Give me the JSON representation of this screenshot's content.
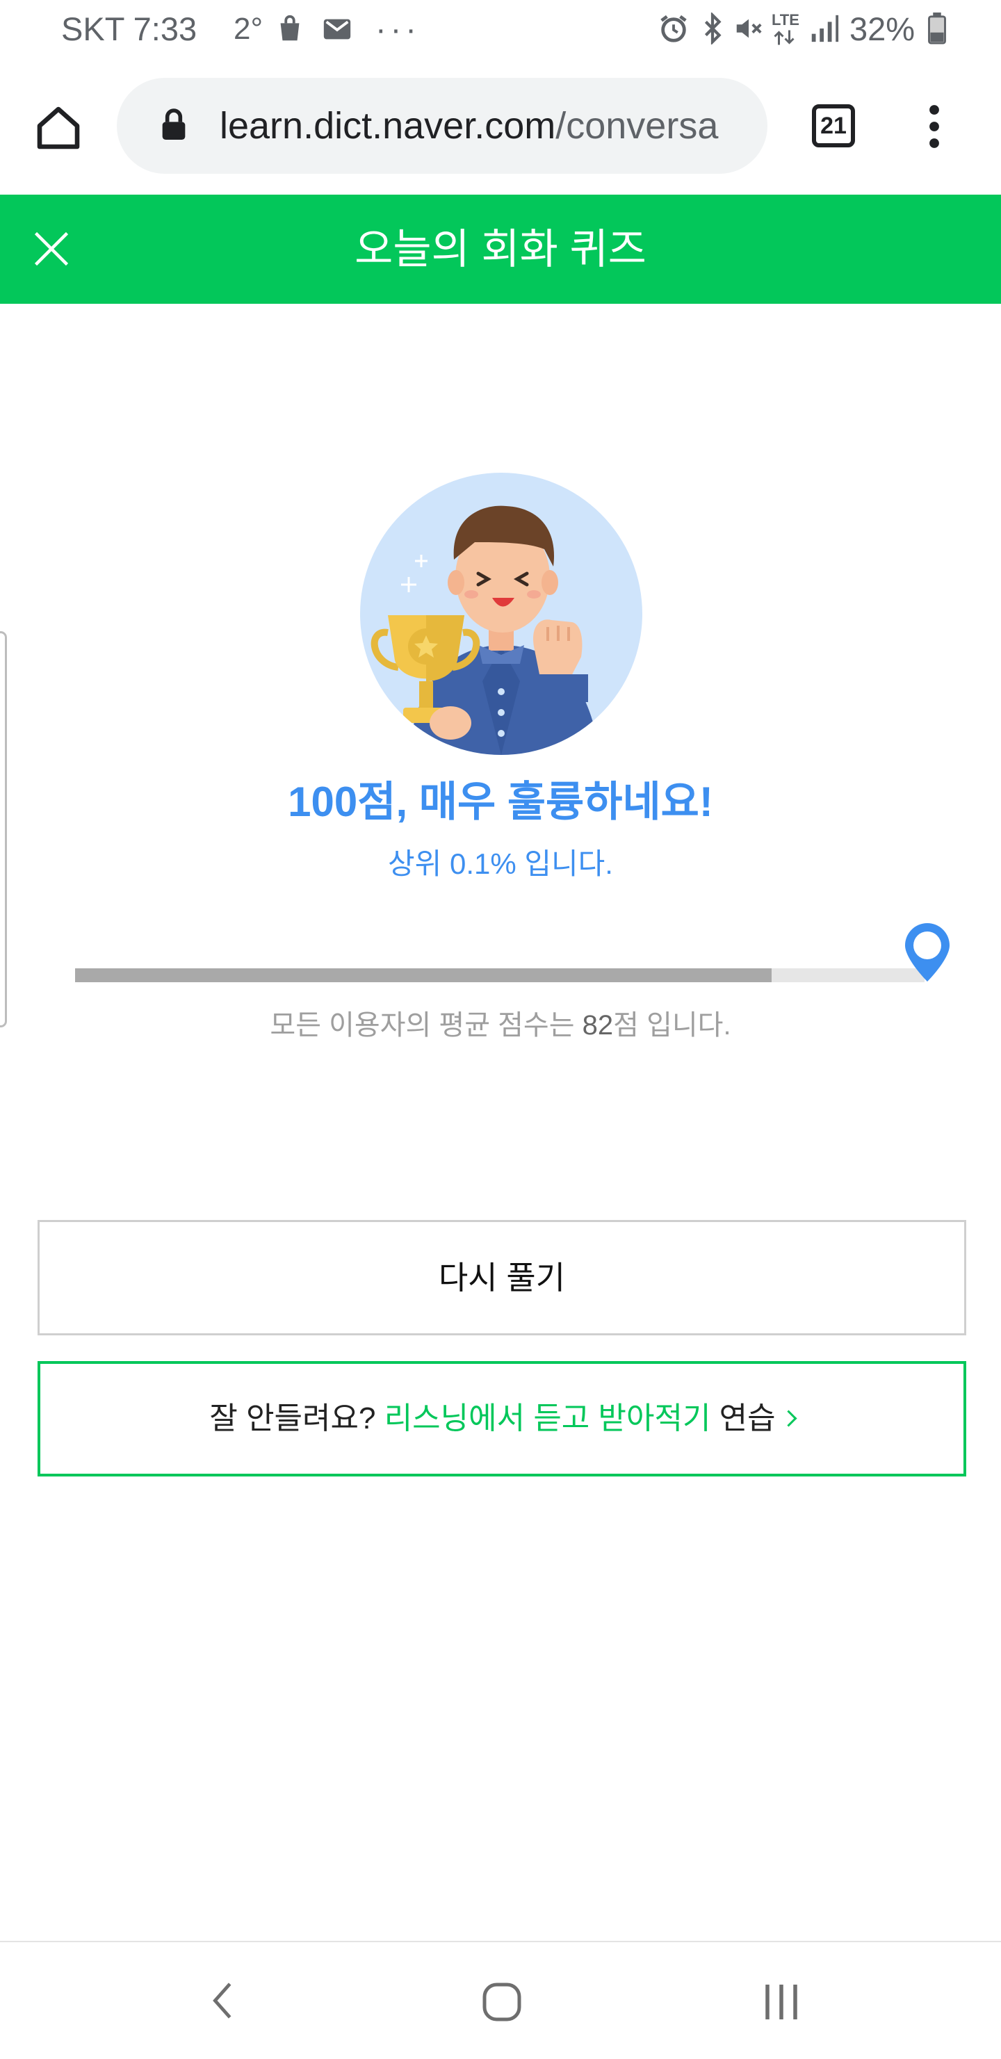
{
  "status_bar": {
    "carrier_time": "SKT 7:33",
    "temperature": "2°",
    "more": "···",
    "network": "LTE",
    "battery": "32%",
    "icons": [
      "shopping-bag-icon",
      "gmail-icon",
      "alarm-icon",
      "bluetooth-icon",
      "mute-icon",
      "signal-icon",
      "battery-icon"
    ]
  },
  "browser": {
    "url_domain": "learn.dict.naver.com",
    "url_path": "/conversa",
    "tab_count": "21"
  },
  "header": {
    "title": "오늘의 회화 퀴즈"
  },
  "result": {
    "score_title": "100점, 매우 훌륭하네요!",
    "rank": "상위 0.1% 입니다."
  },
  "score_bar": {
    "my_score": 100,
    "average_score": 82,
    "max_score": 100
  },
  "average": {
    "prefix": "모든 이용자의 평균 점수는 ",
    "value": "82",
    "suffix": "점 입니다."
  },
  "buttons": {
    "retry": "다시 풀기",
    "listen_prefix": "잘 안들려요? ",
    "listen_link": "리스닝에서 듣고 받아적기",
    "listen_suffix": " 연습"
  },
  "colors": {
    "brand_green": "#03c75a",
    "accent_blue": "#3d8ff0"
  }
}
